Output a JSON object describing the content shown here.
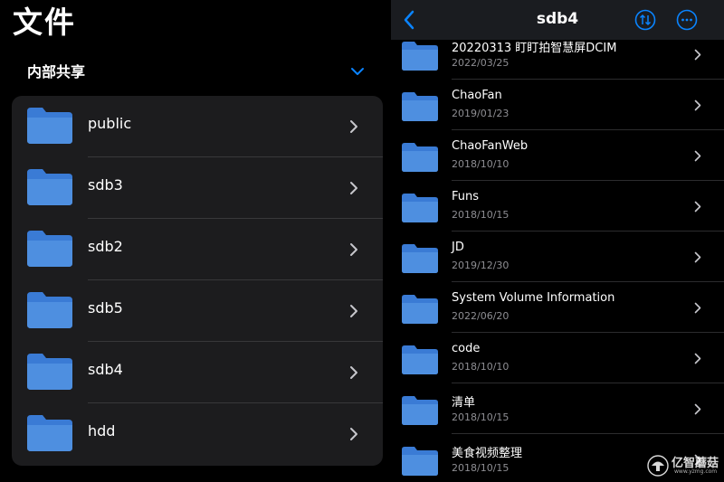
{
  "left": {
    "title": "文件",
    "section": "内部共享",
    "items": [
      {
        "label": "public"
      },
      {
        "label": "sdb3"
      },
      {
        "label": "sdb2"
      },
      {
        "label": "sdb5"
      },
      {
        "label": "sdb4"
      },
      {
        "label": "hdd"
      }
    ]
  },
  "right": {
    "title": "sdb4",
    "files": [
      {
        "name": "20220313 盯盯拍智慧屏DCIM",
        "date": "2022/03/25"
      },
      {
        "name": "ChaoFan",
        "date": "2019/01/23"
      },
      {
        "name": "ChaoFanWeb",
        "date": "2018/10/10"
      },
      {
        "name": "Funs",
        "date": "2018/10/15"
      },
      {
        "name": "JD",
        "date": "2019/12/30"
      },
      {
        "name": "System Volume Information",
        "date": "2022/06/20"
      },
      {
        "name": "code",
        "date": "2018/10/10"
      },
      {
        "name": "清单",
        "date": "2018/10/15"
      },
      {
        "name": "美食视频整理",
        "date": "2018/10/15"
      }
    ]
  },
  "watermark": {
    "text": "亿智蘑菇",
    "url": "www.yzmg.com"
  },
  "colors": {
    "accent": "#0a84ff",
    "folder": "#3a7bd5",
    "folder_light": "#4e8fe0"
  }
}
